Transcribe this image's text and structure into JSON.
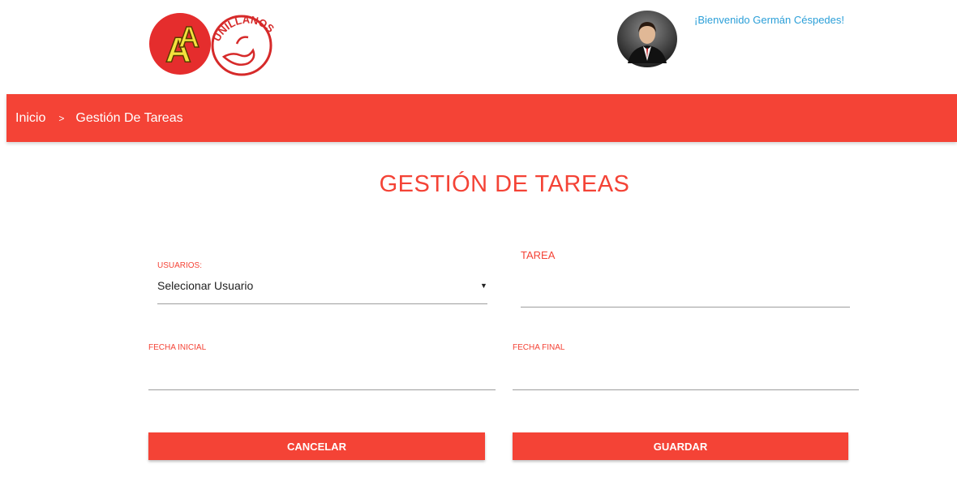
{
  "header": {
    "logo_text": "UNILLANOS",
    "welcome": "¡Bienvenido Germán Céspedes!"
  },
  "breadcrumb": {
    "home": "Inicio",
    "separator": ">",
    "current": "Gestión De Tareas"
  },
  "page": {
    "title": "GESTIÓN DE TAREAS"
  },
  "form": {
    "usuarios_label": "USUARIOS:",
    "usuarios_value": "Selecionar Usuario",
    "tarea_label": "TAREA",
    "fecha_inicial_label": "FECHA INICIAL",
    "fecha_final_label": "FECHA FINAL",
    "cancel_label": "CANCELAR",
    "save_label": "GUARDAR"
  },
  "colors": {
    "primary": "#f44336",
    "welcome_text": "#2b9fd8"
  }
}
